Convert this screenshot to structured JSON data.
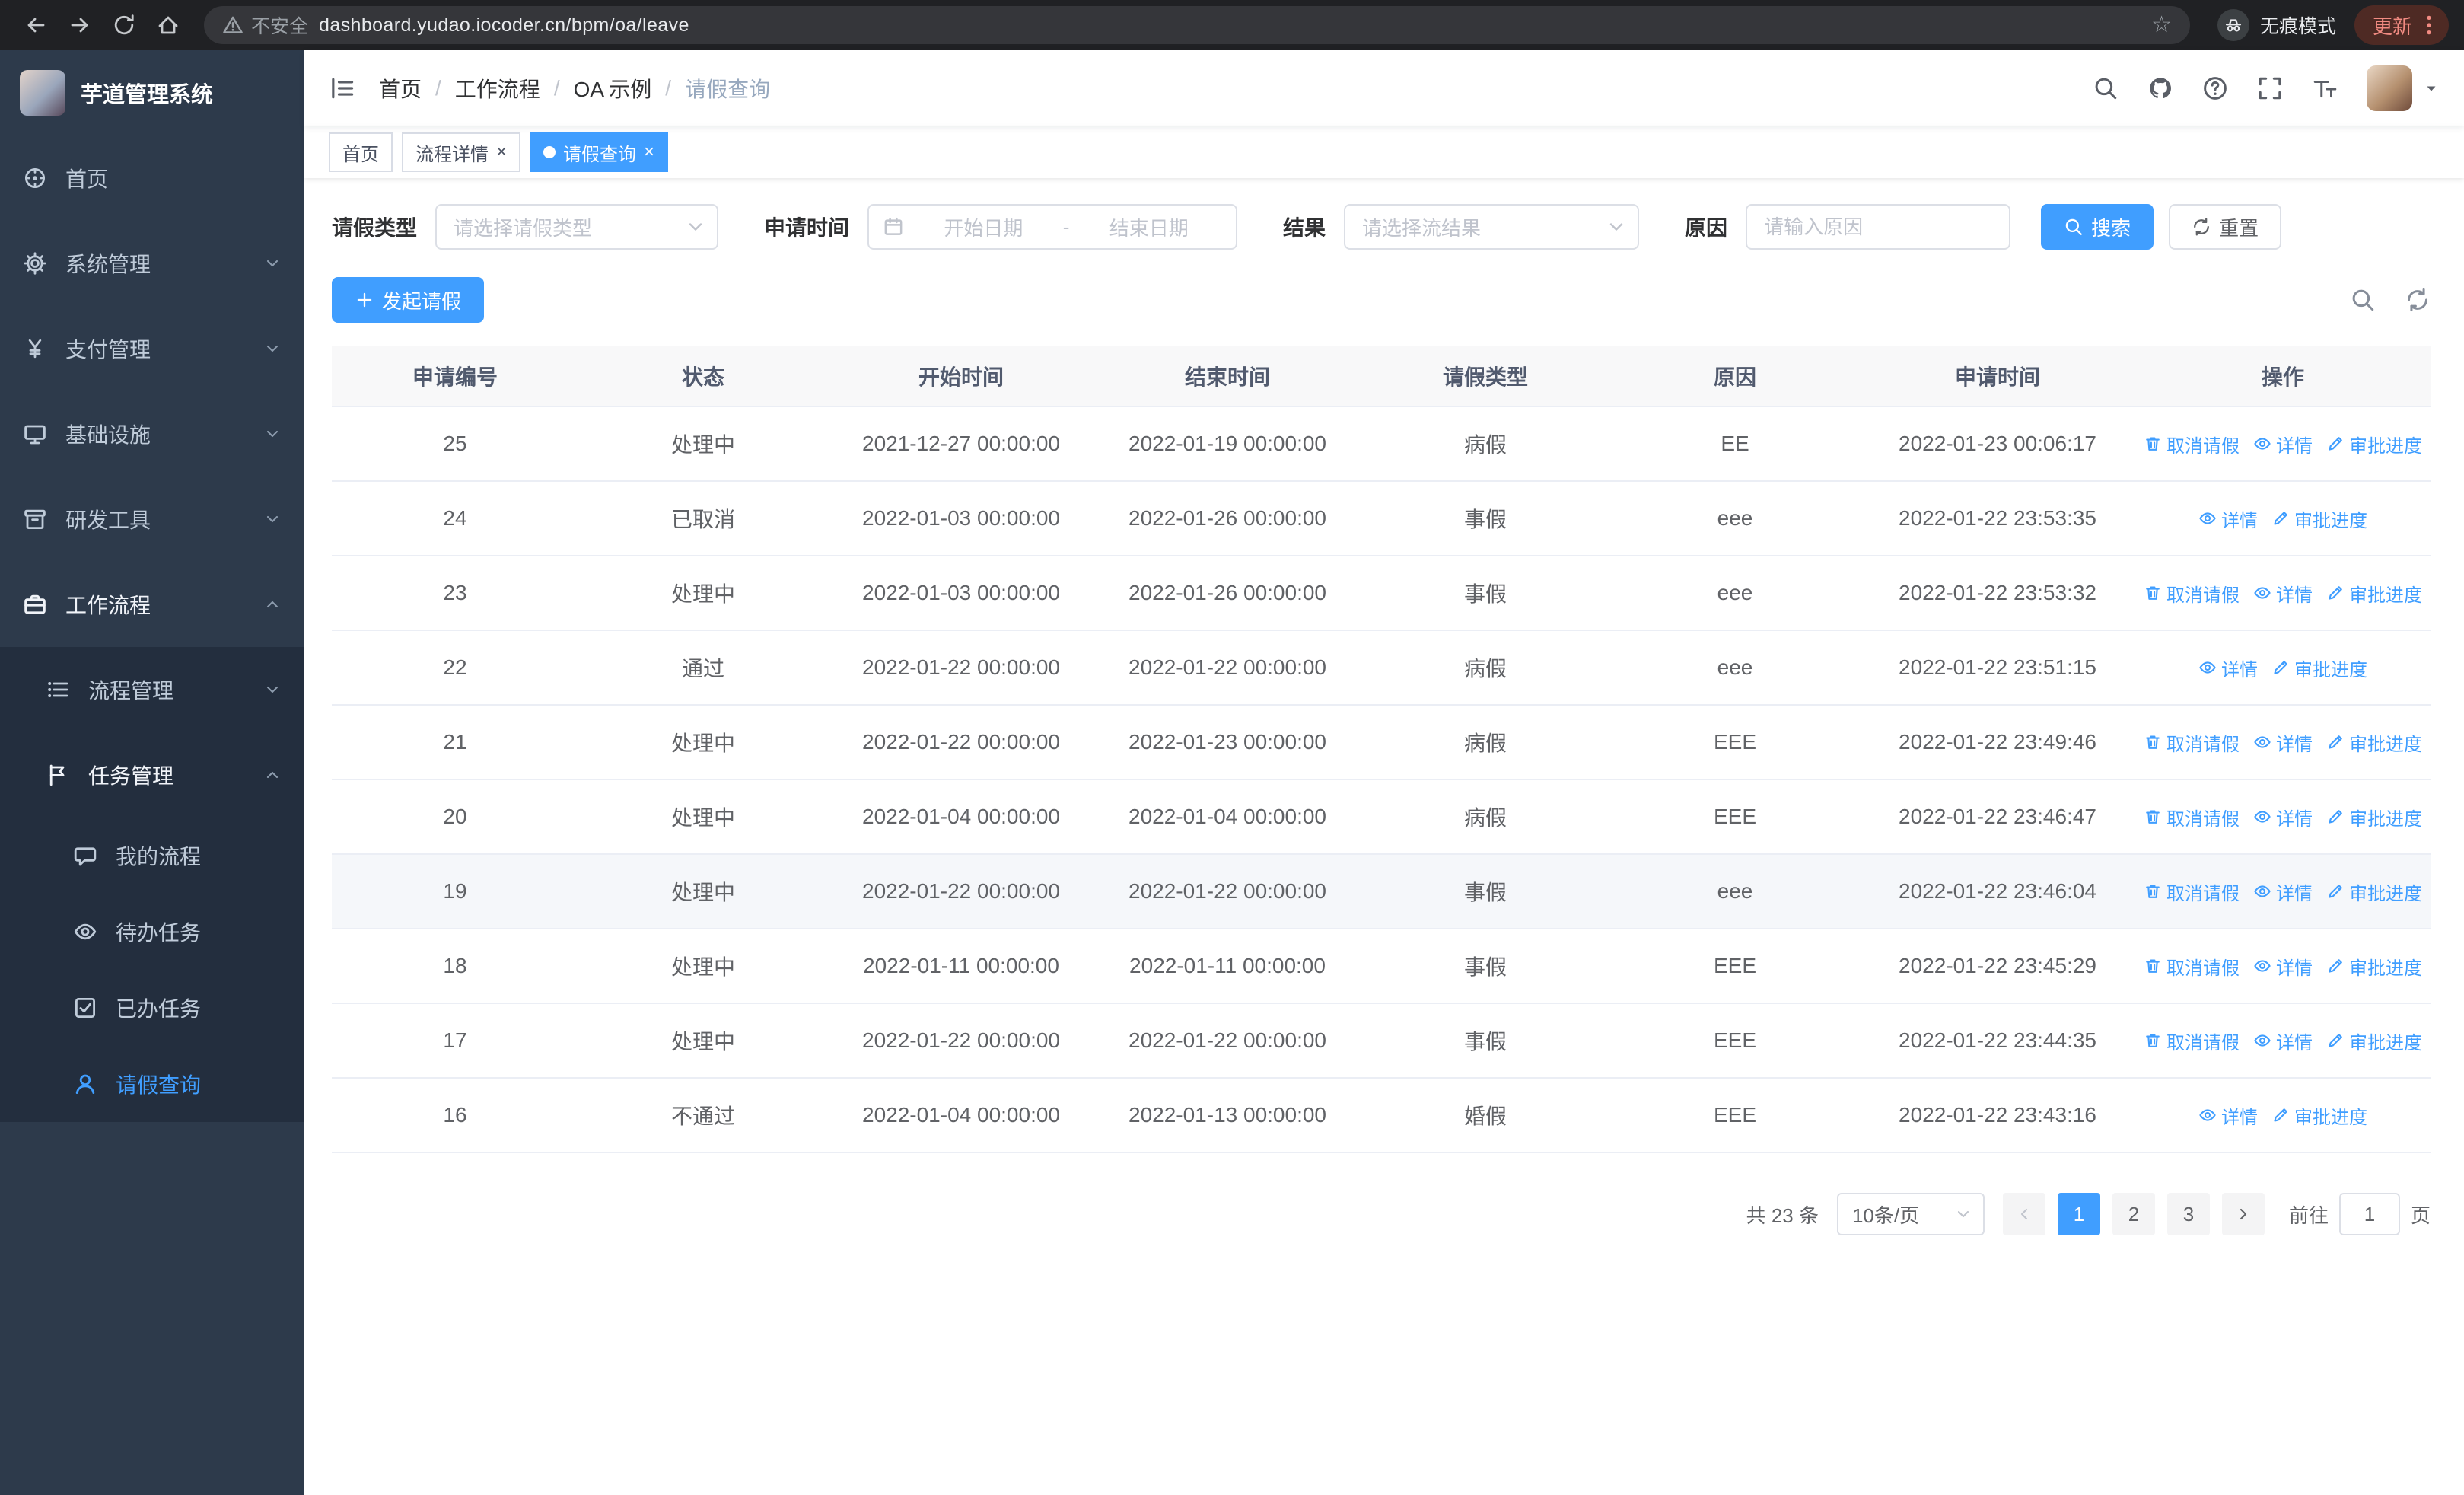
{
  "browser": {
    "security_label": "不安全",
    "url": "dashboard.yudao.iocoder.cn/bpm/oa/leave",
    "incognito_label": "无痕模式",
    "update_label": "更新"
  },
  "icons": {
    "star": "☆",
    "close": "×"
  },
  "app": {
    "logo_title": "芋道管理系统"
  },
  "sidebar": {
    "items": [
      {
        "label": "首页"
      },
      {
        "label": "系统管理"
      },
      {
        "label": "支付管理"
      },
      {
        "label": "基础设施"
      },
      {
        "label": "研发工具"
      },
      {
        "label": "工作流程"
      }
    ],
    "submenu": [
      {
        "label": "流程管理"
      },
      {
        "label": "任务管理"
      }
    ],
    "task_children": [
      {
        "label": "我的流程"
      },
      {
        "label": "待办任务"
      },
      {
        "label": "已办任务"
      },
      {
        "label": "请假查询"
      }
    ]
  },
  "header": {
    "breadcrumb": [
      "首页",
      "工作流程",
      "OA 示例",
      "请假查询"
    ]
  },
  "tabs": [
    {
      "label": "首页"
    },
    {
      "label": "流程详情"
    },
    {
      "label": "请假查询"
    }
  ],
  "filters": {
    "leave_type_label": "请假类型",
    "leave_type_placeholder": "请选择请假类型",
    "apply_time_label": "申请时间",
    "date_start_placeholder": "开始日期",
    "date_separator": "-",
    "date_end_placeholder": "结束日期",
    "result_label": "结果",
    "result_placeholder": "请选择流结果",
    "reason_label": "原因",
    "reason_placeholder": "请输入原因",
    "search_button": "搜索",
    "reset_button": "重置"
  },
  "toolbar": {
    "create_button": "发起请假"
  },
  "table": {
    "columns": [
      "申请编号",
      "状态",
      "开始时间",
      "结束时间",
      "请假类型",
      "原因",
      "申请时间",
      "操作"
    ],
    "actions": {
      "cancel": "取消请假",
      "detail": "详情",
      "progress": "审批进度"
    },
    "rows": [
      {
        "id": "25",
        "status": "处理中",
        "start": "2021-12-27 00:00:00",
        "end": "2022-01-19 00:00:00",
        "type": "病假",
        "reason": "EE",
        "applied": "2022-01-23 00:06:17",
        "actions": [
          "cancel",
          "detail",
          "progress"
        ]
      },
      {
        "id": "24",
        "status": "已取消",
        "start": "2022-01-03 00:00:00",
        "end": "2022-01-26 00:00:00",
        "type": "事假",
        "reason": "eee",
        "applied": "2022-01-22 23:53:35",
        "actions": [
          "detail",
          "progress"
        ]
      },
      {
        "id": "23",
        "status": "处理中",
        "start": "2022-01-03 00:00:00",
        "end": "2022-01-26 00:00:00",
        "type": "事假",
        "reason": "eee",
        "applied": "2022-01-22 23:53:32",
        "actions": [
          "cancel",
          "detail",
          "progress"
        ]
      },
      {
        "id": "22",
        "status": "通过",
        "start": "2022-01-22 00:00:00",
        "end": "2022-01-22 00:00:00",
        "type": "病假",
        "reason": "eee",
        "applied": "2022-01-22 23:51:15",
        "actions": [
          "detail",
          "progress"
        ]
      },
      {
        "id": "21",
        "status": "处理中",
        "start": "2022-01-22 00:00:00",
        "end": "2022-01-23 00:00:00",
        "type": "病假",
        "reason": "EEE",
        "applied": "2022-01-22 23:49:46",
        "actions": [
          "cancel",
          "detail",
          "progress"
        ]
      },
      {
        "id": "20",
        "status": "处理中",
        "start": "2022-01-04 00:00:00",
        "end": "2022-01-04 00:00:00",
        "type": "病假",
        "reason": "EEE",
        "applied": "2022-01-22 23:46:47",
        "actions": [
          "cancel",
          "detail",
          "progress"
        ]
      },
      {
        "id": "19",
        "status": "处理中",
        "start": "2022-01-22 00:00:00",
        "end": "2022-01-22 00:00:00",
        "type": "事假",
        "reason": "eee",
        "applied": "2022-01-22 23:46:04",
        "actions": [
          "cancel",
          "detail",
          "progress"
        ],
        "highlight": true
      },
      {
        "id": "18",
        "status": "处理中",
        "start": "2022-01-11 00:00:00",
        "end": "2022-01-11 00:00:00",
        "type": "事假",
        "reason": "EEE",
        "applied": "2022-01-22 23:45:29",
        "actions": [
          "cancel",
          "detail",
          "progress"
        ]
      },
      {
        "id": "17",
        "status": "处理中",
        "start": "2022-01-22 00:00:00",
        "end": "2022-01-22 00:00:00",
        "type": "事假",
        "reason": "EEE",
        "applied": "2022-01-22 23:44:35",
        "actions": [
          "cancel",
          "detail",
          "progress"
        ]
      },
      {
        "id": "16",
        "status": "不通过",
        "start": "2022-01-04 00:00:00",
        "end": "2022-01-13 00:00:00",
        "type": "婚假",
        "reason": "EEE",
        "applied": "2022-01-22 23:43:16",
        "actions": [
          "detail",
          "progress"
        ]
      }
    ]
  },
  "pagination": {
    "total": "共 23 条",
    "page_size": "10条/页",
    "pages": [
      "1",
      "2",
      "3"
    ],
    "goto_label": "前往",
    "goto_value": "1",
    "goto_unit": "页"
  }
}
